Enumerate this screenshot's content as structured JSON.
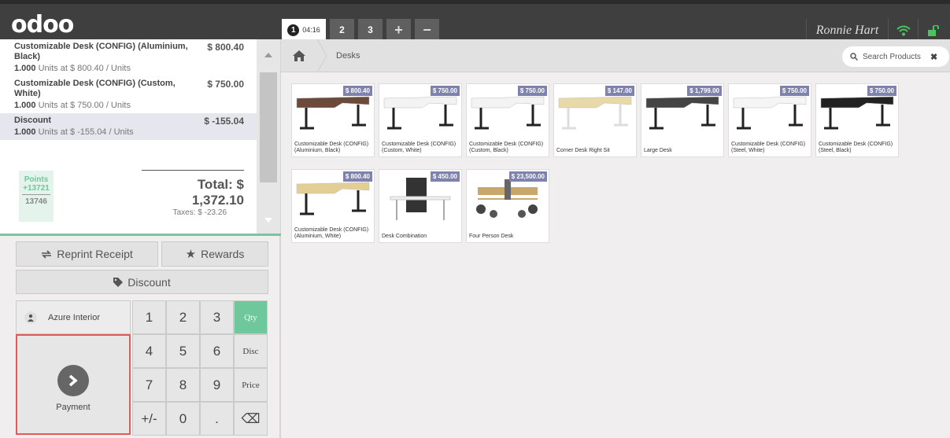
{
  "header": {
    "logo": "odoo",
    "tabs": [
      {
        "number": "1",
        "time": "04:16",
        "active": true
      },
      {
        "number": "2"
      },
      {
        "number": "3"
      }
    ],
    "add_icon": "+",
    "remove_icon": "−",
    "user": "Ronnie Hart",
    "wifi_icon": "wifi-icon",
    "lock_icon": "lock-icon",
    "accent_color": "#6ec89b"
  },
  "order": {
    "lines": [
      {
        "name": "Customizable Desk (CONFIG) (Aluminium, Black)",
        "price": "$ 800.40",
        "qty": "1.000",
        "unit_info": "Units at $ 800.40 / Units"
      },
      {
        "name": "Customizable Desk (CONFIG) (Custom, White)",
        "price": "$ 750.00",
        "qty": "1.000",
        "unit_info": "Units at $ 750.00 / Units"
      },
      {
        "name": "Discount",
        "price": "$ -155.04",
        "qty": "1.000",
        "unit_info": "Units at $ -155.04 / Units"
      }
    ],
    "points_label": "Points",
    "points_won": "+13721",
    "points_total": "13746",
    "total": "Total: $ 1,372.10",
    "taxes": "Taxes: $ -23.26"
  },
  "actions": {
    "reprint": "Reprint Receipt",
    "rewards": "Rewards",
    "discount": "Discount"
  },
  "numpad": {
    "customer": "Azure Interior",
    "payment": "Payment",
    "keys": [
      "1",
      "2",
      "3",
      "4",
      "5",
      "6",
      "7",
      "8",
      "9",
      "+/-",
      "0",
      "."
    ],
    "modes": [
      "Qty",
      "Disc",
      "Price"
    ],
    "backspace": "⌫"
  },
  "products_panel": {
    "breadcrumb": "Desks",
    "search_placeholder": "Search Products",
    "products": [
      {
        "name": "Customizable Desk (CONFIG) (Aluminium, Black)",
        "price": "$ 800.40"
      },
      {
        "name": "Customizable Desk (CONFIG) (Custom, White)",
        "price": "$ 750.00"
      },
      {
        "name": "Customizable Desk (CONFIG) (Custom, Black)",
        "price": "$ 750.00"
      },
      {
        "name": "Corner Desk Right Sit",
        "price": "$ 147.00"
      },
      {
        "name": "Large Desk",
        "price": "$ 1,799.00"
      },
      {
        "name": "Customizable Desk (CONFIG) (Steel, White)",
        "price": "$ 750.00"
      },
      {
        "name": "Customizable Desk (CONFIG) (Steel, Black)",
        "price": "$ 750.00"
      },
      {
        "name": "Customizable Desk (CONFIG) (Aluminium, White)",
        "price": "$ 800.40"
      },
      {
        "name": "Desk Combination",
        "price": "$ 450.00"
      },
      {
        "name": "Four Person Desk",
        "price": "$ 23,500.00"
      }
    ]
  }
}
